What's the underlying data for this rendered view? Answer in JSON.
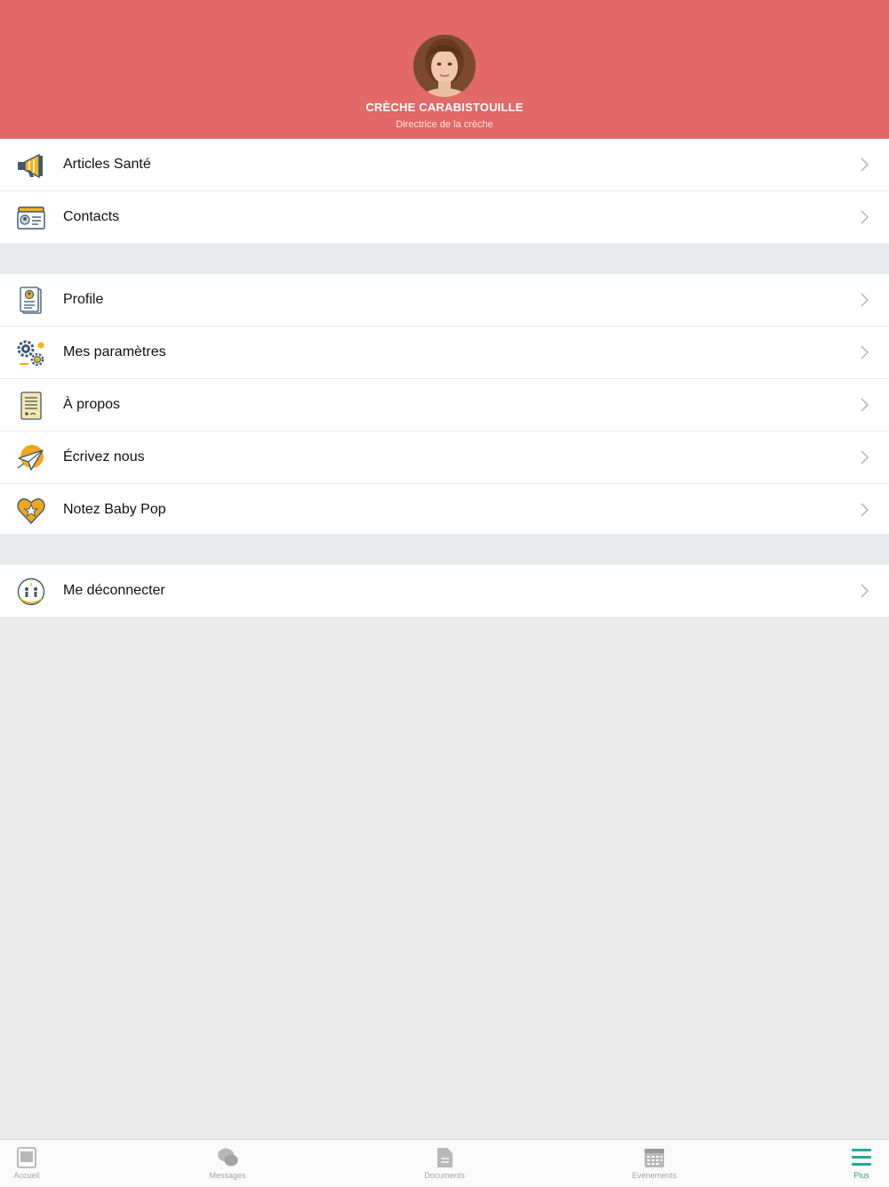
{
  "header": {
    "title": "CRÈCHE CARABISTOUILLE",
    "subtitle": "Directrice de la crèche",
    "background_color": "#e36868"
  },
  "sections": [
    {
      "items": [
        {
          "label": "Articles Santé",
          "icon": "megaphone-icon"
        },
        {
          "label": "Contacts",
          "icon": "contact-card-icon"
        }
      ]
    },
    {
      "items": [
        {
          "label": "Profile",
          "icon": "profile-document-icon"
        },
        {
          "label": "Mes paramètres",
          "icon": "settings-gears-icon"
        },
        {
          "label": "À propos",
          "icon": "about-document-icon"
        },
        {
          "label": "Écrivez nous",
          "icon": "paper-plane-icon"
        },
        {
          "label": "Notez Baby Pop",
          "icon": "heart-star-icon"
        }
      ]
    },
    {
      "items": [
        {
          "label": "Me déconnecter",
          "icon": "logout-icon"
        }
      ]
    }
  ],
  "tabbar": {
    "active_color": "#2aa59a",
    "inactive_color": "#a3a3a3",
    "tabs": [
      {
        "label": "Accueil",
        "icon": "home-icon",
        "active": false
      },
      {
        "label": "Messages",
        "icon": "chat-bubbles-icon",
        "active": false
      },
      {
        "label": "Documents",
        "icon": "document-icon",
        "active": false
      },
      {
        "label": "Evénements",
        "icon": "calendar-icon",
        "active": false
      },
      {
        "label": "Plus",
        "icon": "menu-icon",
        "active": true
      }
    ]
  }
}
